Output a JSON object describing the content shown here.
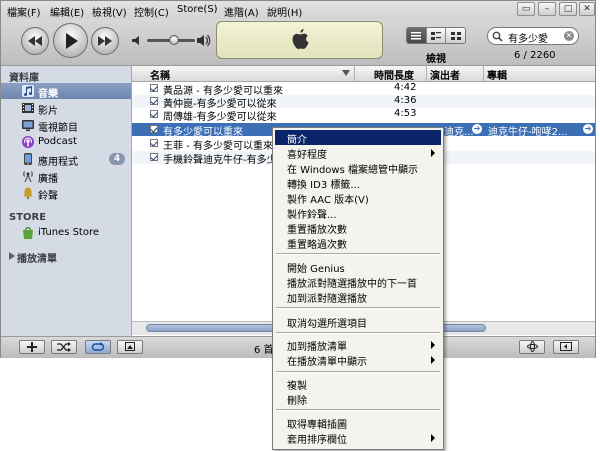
{
  "menubar": {
    "items": [
      "檔案(F)",
      "編輯(E)",
      "檢視(V)",
      "控制(C)",
      "Store(S)",
      "進階(A)",
      "說明(H)"
    ]
  },
  "toolbar": {
    "view_label": "檢視",
    "search_value": "有多少愛",
    "count": "6 / 2260"
  },
  "sidebar": {
    "library_header": "資料庫",
    "library_items": [
      {
        "label": "音樂",
        "icon": "music-note-icon"
      },
      {
        "label": "影片",
        "icon": "film-icon"
      },
      {
        "label": "電視節目",
        "icon": "tv-icon"
      },
      {
        "label": "Podcast",
        "icon": "podcast-icon"
      },
      {
        "label": "應用程式",
        "icon": "app-icon",
        "badge": "4"
      },
      {
        "label": "廣播",
        "icon": "radio-icon"
      },
      {
        "label": "鈴聲",
        "icon": "bell-icon"
      }
    ],
    "store_header": "STORE",
    "store_item": "iTunes Store",
    "playlists_header": "播放清單"
  },
  "list": {
    "columns": {
      "name": "名稱",
      "time": "時間長度",
      "artist": "演出者",
      "album": "專輯"
    },
    "rows": [
      {
        "name": "黃品源 - 有多少愛可以重來",
        "time": "4:42"
      },
      {
        "name": "黃仲崑-有多少愛可以從來",
        "time": "4:36"
      },
      {
        "name": "周傳雄-有多少愛可以從來",
        "time": "4:53"
      },
      {
        "name": "有多少愛可以重來",
        "time": "",
        "artist": "迪克...",
        "album": "迪克牛仔-咆哮2..."
      },
      {
        "name": "王菲 - 有多少愛可以重來",
        "time": ""
      },
      {
        "name": "手機鈴聲迪克牛仔-有多少",
        "time": ""
      }
    ]
  },
  "status": {
    "text": "6 首"
  },
  "context_menu": {
    "items": [
      {
        "label": "簡介",
        "highlighted": true
      },
      {
        "label": "喜好程度",
        "submenu": true
      },
      {
        "label": "在 Windows 檔案總管中顯示"
      },
      {
        "label": "轉換 ID3 標籤..."
      },
      {
        "label": "製作 AAC 版本(V)"
      },
      {
        "label": "製作鈴聲..."
      },
      {
        "label": "重置播放次數"
      },
      {
        "label": "重置略過次數"
      },
      {
        "separator": true
      },
      {
        "label": "開始 Genius"
      },
      {
        "label": "播放派對隨選播放中的下一首"
      },
      {
        "label": "加到派對隨選播放"
      },
      {
        "separator": true
      },
      {
        "label": "取消勾選所選項目"
      },
      {
        "separator": true
      },
      {
        "label": "加到播放清單",
        "submenu": true
      },
      {
        "label": "在播放清單中顯示",
        "submenu": true
      },
      {
        "separator": true
      },
      {
        "label": "複製"
      },
      {
        "label": "刪除"
      },
      {
        "separator": true
      },
      {
        "label": "取得專輯插圖"
      },
      {
        "label": "套用排序欄位",
        "submenu": true
      }
    ]
  },
  "colors": {
    "selection": "#3d6fb6",
    "menu_highlight": "#0a246a",
    "sidebar_bg": "#d4dbe5",
    "lcd_bg": "#e9e9c8"
  }
}
